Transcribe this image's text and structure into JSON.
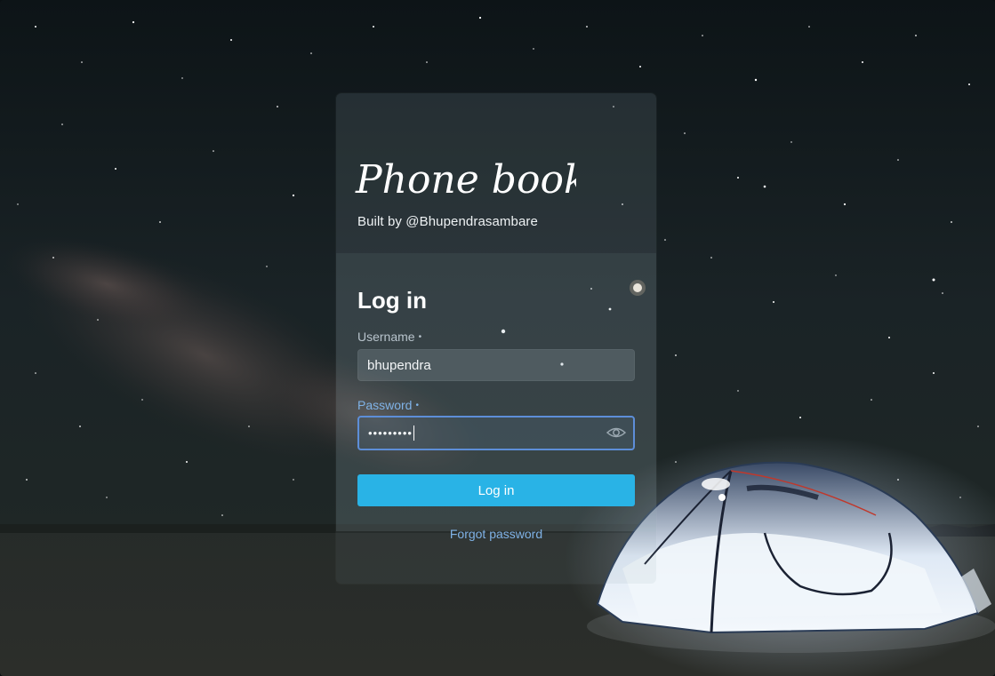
{
  "brand": {
    "logo_text": "Phone book",
    "byline": "Built by @Bhupendrasambare"
  },
  "form": {
    "heading": "Log in",
    "username": {
      "label": "Username",
      "required_mark": "•",
      "value": "bhupendra"
    },
    "password": {
      "label": "Password",
      "required_mark": "•",
      "masked_value": "•••••••••",
      "toggle_icon": "eye-icon"
    },
    "submit_label": "Log in",
    "forgot_label": "Forgot password"
  },
  "colors": {
    "accent": "#29b3e6",
    "link": "#7fb2e6",
    "focus_border": "#5d8ed8"
  }
}
